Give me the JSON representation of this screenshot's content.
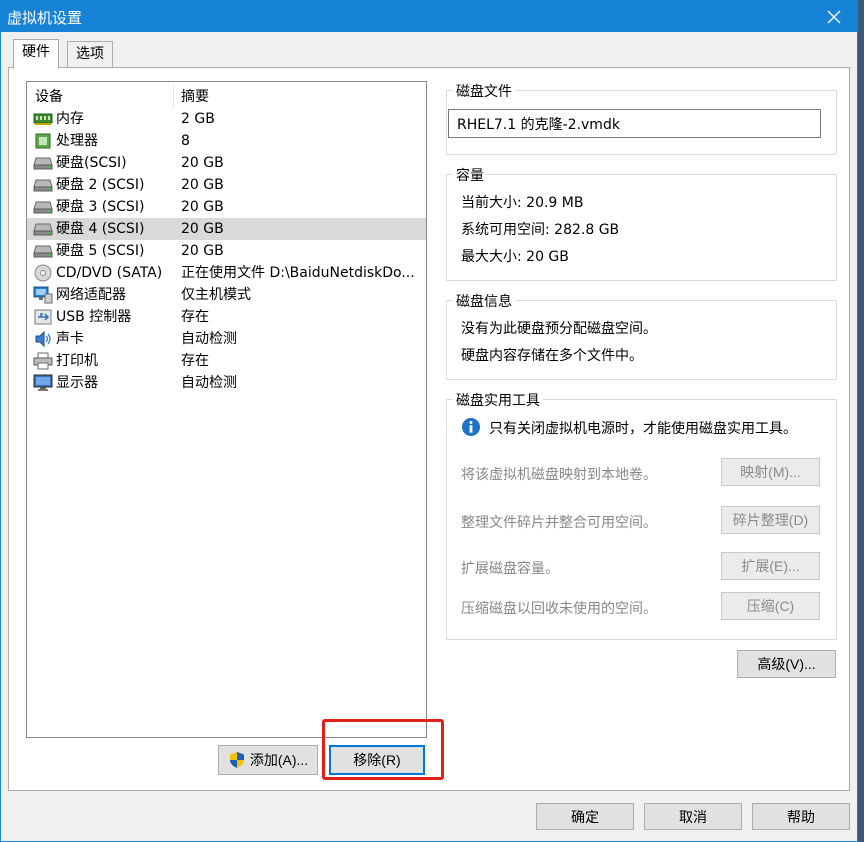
{
  "window": {
    "title": "虚拟机设置"
  },
  "tabs": [
    {
      "label": "硬件",
      "active": true
    },
    {
      "label": "选项",
      "active": false
    }
  ],
  "device_list": {
    "columns": [
      "设备",
      "摘要"
    ],
    "rows": [
      {
        "name": "内存",
        "summary": "2 GB",
        "icon": "memory-icon",
        "selected": false
      },
      {
        "name": "处理器",
        "summary": "8",
        "icon": "cpu-icon",
        "selected": false
      },
      {
        "name": "硬盘(SCSI)",
        "summary": "20 GB",
        "icon": "hard-disk-icon",
        "selected": false
      },
      {
        "name": "硬盘 2 (SCSI)",
        "summary": "20 GB",
        "icon": "hard-disk-icon",
        "selected": false
      },
      {
        "name": "硬盘 3 (SCSI)",
        "summary": "20 GB",
        "icon": "hard-disk-icon",
        "selected": false
      },
      {
        "name": "硬盘 4 (SCSI)",
        "summary": "20 GB",
        "icon": "hard-disk-icon",
        "selected": true
      },
      {
        "name": "硬盘 5 (SCSI)",
        "summary": "20 GB",
        "icon": "hard-disk-icon",
        "selected": false
      },
      {
        "name": "CD/DVD (SATA)",
        "summary": "正在使用文件 D:\\BaiduNetdiskDo...",
        "icon": "cd-dvd-icon",
        "selected": false
      },
      {
        "name": "网络适配器",
        "summary": "仅主机模式",
        "icon": "network-adapter-icon",
        "selected": false
      },
      {
        "name": "USB 控制器",
        "summary": "存在",
        "icon": "usb-icon",
        "selected": false
      },
      {
        "name": "声卡",
        "summary": "自动检测",
        "icon": "sound-card-icon",
        "selected": false
      },
      {
        "name": "打印机",
        "summary": "存在",
        "icon": "printer-icon",
        "selected": false
      },
      {
        "name": "显示器",
        "summary": "自动检测",
        "icon": "monitor-icon",
        "selected": false
      }
    ]
  },
  "list_buttons": {
    "add": "添加(A)...",
    "remove": "移除(R)"
  },
  "disk_file": {
    "title": "磁盘文件",
    "value": "RHEL7.1 的克隆-2.vmdk"
  },
  "capacity": {
    "title": "容量",
    "current_size": "当前大小: 20.9 MB",
    "available_space": "系统可用空间: 282.8 GB",
    "max_size": "最大大小: 20 GB"
  },
  "disk_info": {
    "title": "磁盘信息",
    "line1": "没有为此硬盘预分配磁盘空间。",
    "line2": "硬盘内容存储在多个文件中。"
  },
  "disk_utilities": {
    "title": "磁盘实用工具",
    "notice": "只有关闭虚拟机电源时，才能使用磁盘实用工具。",
    "map_desc": "将该虚拟机磁盘映射到本地卷。",
    "map_button": "映射(M)...",
    "defrag_desc": "整理文件碎片并整合可用空间。",
    "defrag_button": "碎片整理(D)",
    "expand_desc": "扩展磁盘容量。",
    "expand_button": "扩展(E)...",
    "compact_desc": "压缩磁盘以回收未使用的空间。",
    "compact_button": "压缩(C)"
  },
  "advanced_button": "高级(V)...",
  "footer": {
    "ok": "确定",
    "cancel": "取消",
    "help": "帮助"
  },
  "colors": {
    "titlebar": "#1783d6",
    "highlight": "#e0201a",
    "selected_row": "#d9d9d9"
  }
}
